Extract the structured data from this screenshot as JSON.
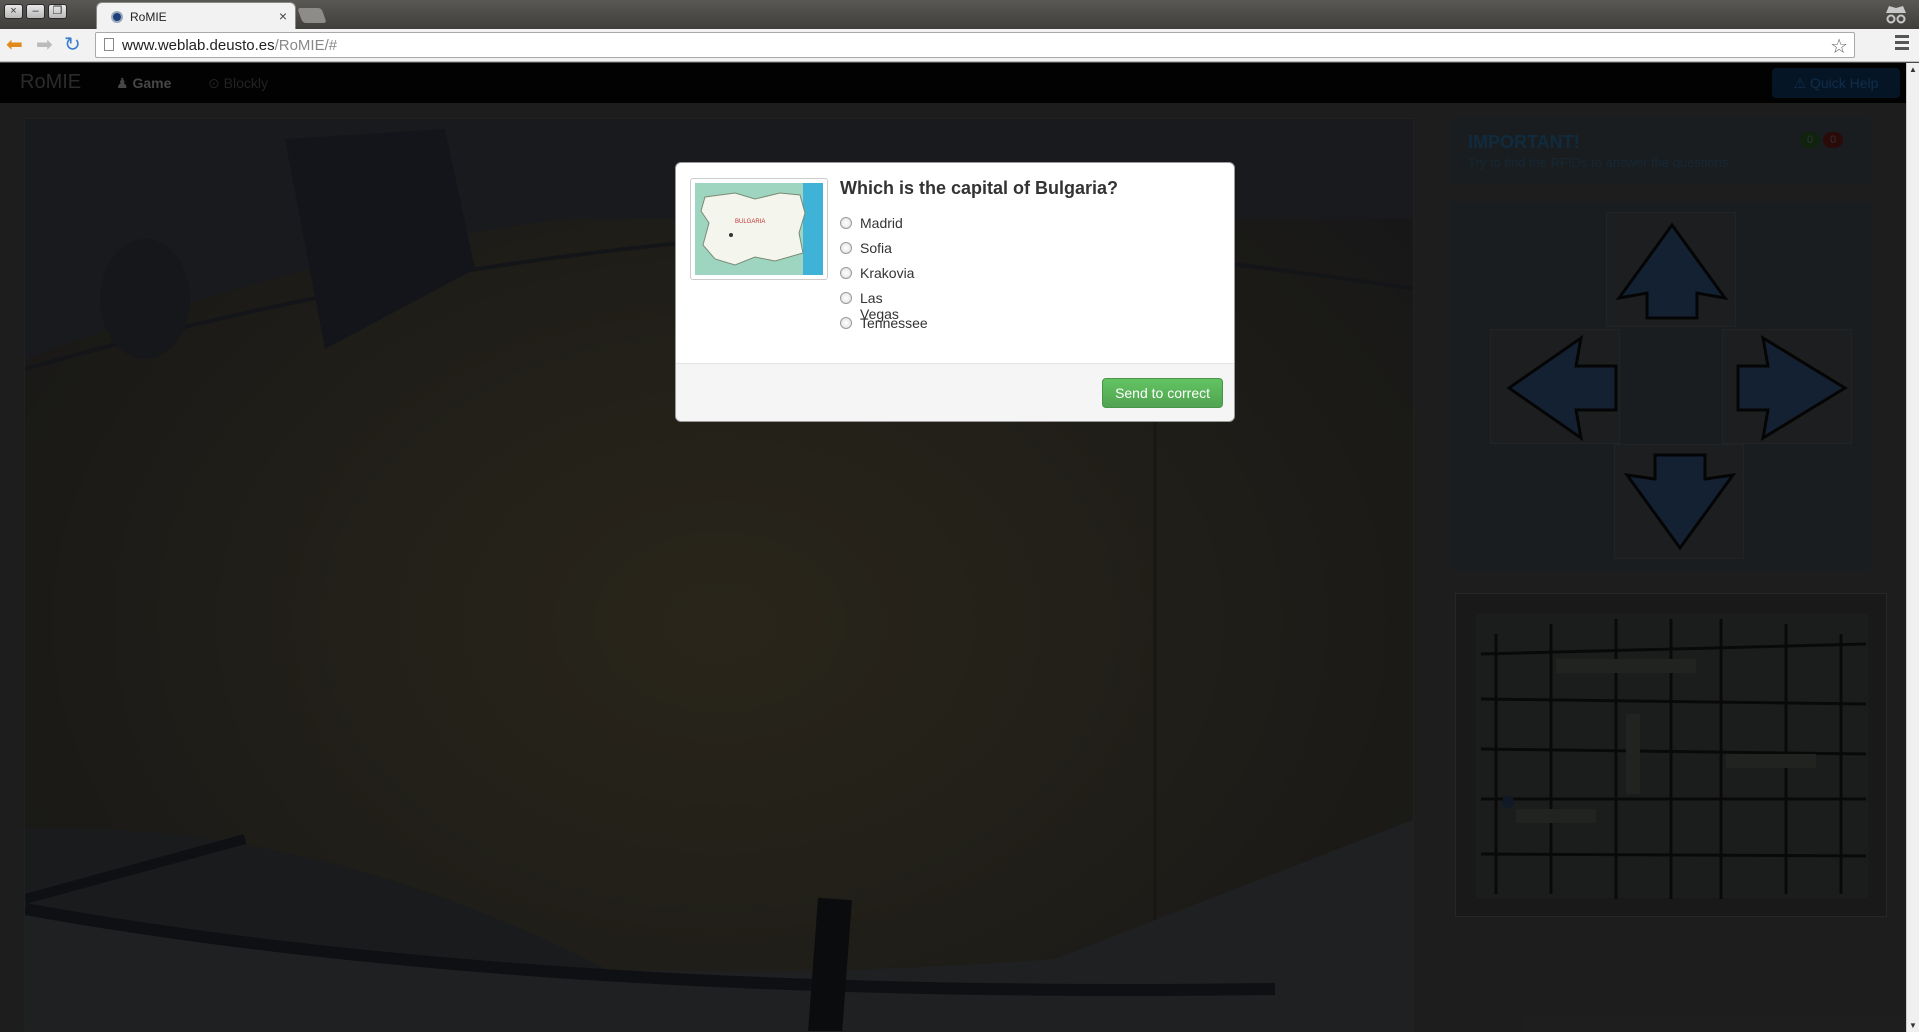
{
  "browser": {
    "tab_title": "RoMIE",
    "tab_close": "×",
    "url_host": "www.weblab.deusto.es",
    "url_path": "/RoMIE/#",
    "window_buttons": [
      "×",
      "–",
      "❐"
    ]
  },
  "navbar": {
    "brand": "RoMIE",
    "links": [
      {
        "label": "Game",
        "icon": "person-icon",
        "active": true
      },
      {
        "label": "Blockly",
        "icon": "circle-icon",
        "active": false
      }
    ],
    "quick_help": "Quick Help"
  },
  "alert": {
    "title": "IMPORTANT!",
    "text": "Try to find the RFIDs to answer the questions.",
    "score_correct": "0",
    "score_wrong": "0"
  },
  "controls": {
    "buttons": [
      "arrow-up-icon",
      "arrow-left-icon",
      "arrow-right-icon",
      "arrow-down-icon"
    ],
    "arrow_color": "#213a57"
  },
  "modal": {
    "map_label": "BULGARIA",
    "question": "Which is the capital of Bulgaria?",
    "options": [
      "Madrid",
      "Sofia",
      "Krakovia",
      "Las Vegas",
      "Tennessee"
    ],
    "submit": "Send to correct"
  },
  "colors": {
    "overlay": "rgba(0,0,0,0.8)",
    "success": "#5bb75b",
    "badge_green": "#1b3d1b",
    "badge_red": "#4a1212"
  }
}
